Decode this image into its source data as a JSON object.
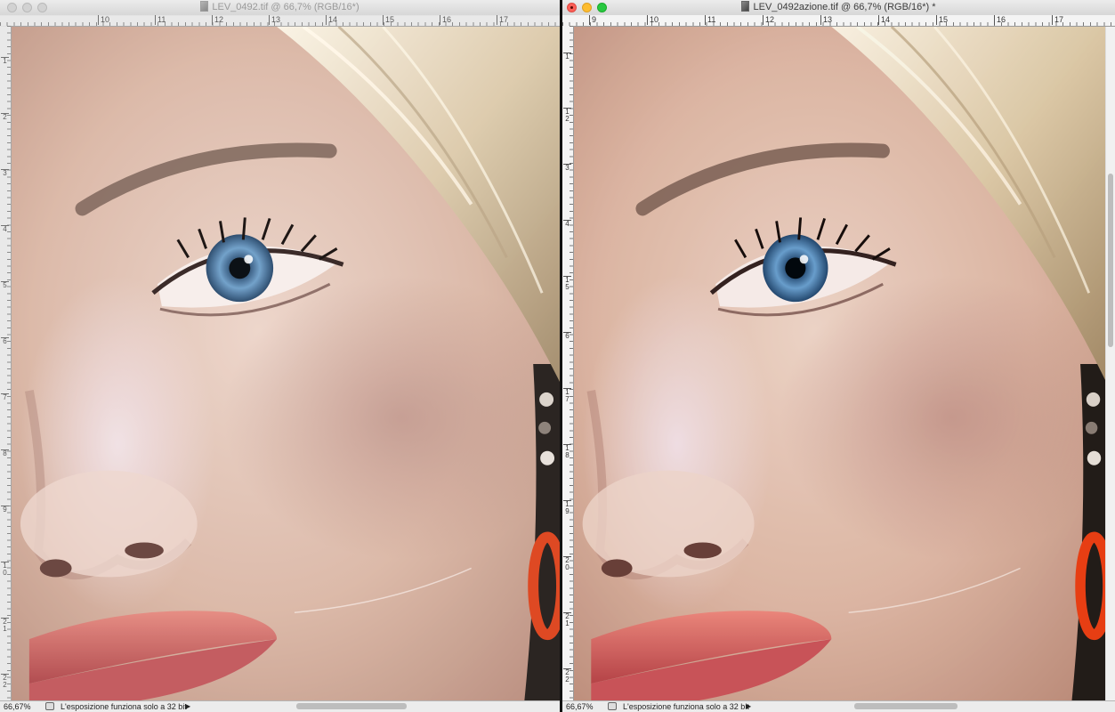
{
  "windows": {
    "left": {
      "title": "LEV_0492.tif @ 66,7% (RGB/16*)",
      "ruler_h": [
        "10",
        "11",
        "12",
        "13",
        "14",
        "15",
        "16",
        "17"
      ],
      "ruler_v": [
        "1",
        "2",
        "3",
        "4",
        "5",
        "6",
        "7",
        "8",
        "9",
        "1 0",
        "2 1",
        "2 2"
      ],
      "zoom": "66,67%",
      "status": "L'esposizione funziona solo a 32 bit"
    },
    "right": {
      "title": "LEV_0492azione.tif @ 66,7% (RGB/16*) *",
      "ruler_h": [
        "9",
        "10",
        "11",
        "12",
        "13",
        "14",
        "15",
        "16",
        "17"
      ],
      "ruler_v": [
        "1",
        "1 2",
        "3",
        "4",
        "1 5",
        "6",
        "1 7",
        "1 8",
        "1 9",
        "2 0",
        "2 1",
        "2 2"
      ],
      "zoom": "66,67%",
      "status": "L'esposizione funziona solo a 32 bit"
    }
  },
  "icons": {
    "document": "tif-document-icon",
    "status": "cloud-status-icon",
    "menu": "triangle-right-icon"
  },
  "colors": {
    "close": "#fc5f57",
    "minimize": "#fdbc2e",
    "zoom": "#28c840"
  }
}
